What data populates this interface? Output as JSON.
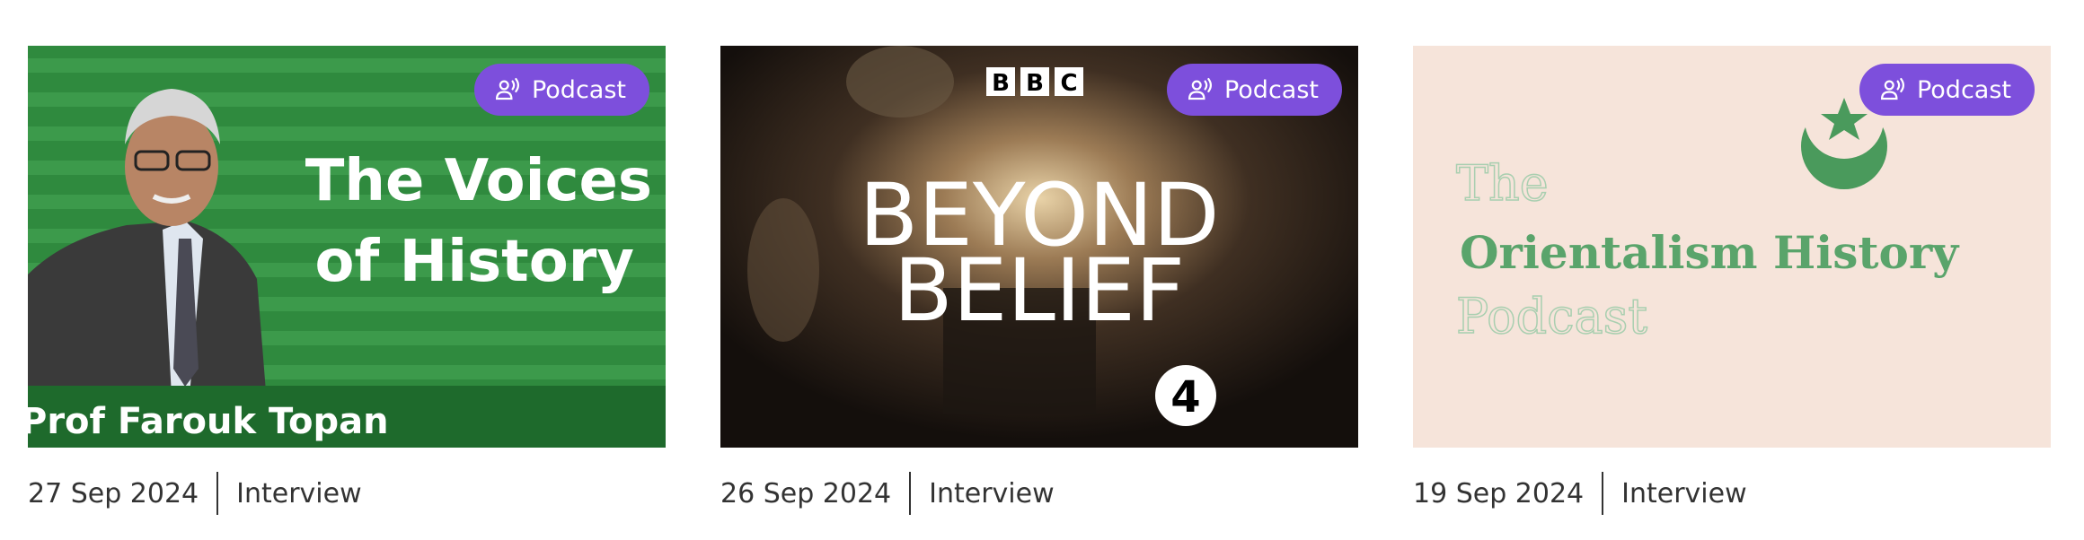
{
  "cards": [
    {
      "badge_label": "Podcast",
      "badge_icon": "podcast-speaker-icon",
      "date": "27 Sep 2024",
      "category": "Interview",
      "thumbnail": {
        "title_line1": "The Voices",
        "title_line2": "of History",
        "caption": "Prof Farouk Topan",
        "background_color": "#2f8a3e"
      }
    },
    {
      "badge_label": "Podcast",
      "badge_icon": "podcast-speaker-icon",
      "date": "26 Sep 2024",
      "category": "Interview",
      "thumbnail": {
        "logo_letters": [
          "B",
          "B",
          "C"
        ],
        "title_line1": "BEYOND",
        "title_line2": "BELIEF",
        "channel_number": "4"
      }
    },
    {
      "badge_label": "Podcast",
      "badge_icon": "podcast-speaker-icon",
      "date": "19 Sep 2024",
      "category": "Interview",
      "thumbnail": {
        "line1": "The",
        "line2": "Orientalism History",
        "line3": "Podcast",
        "background_color": "#f6e4da",
        "accent_color": "#4a9a5c"
      }
    }
  ]
}
